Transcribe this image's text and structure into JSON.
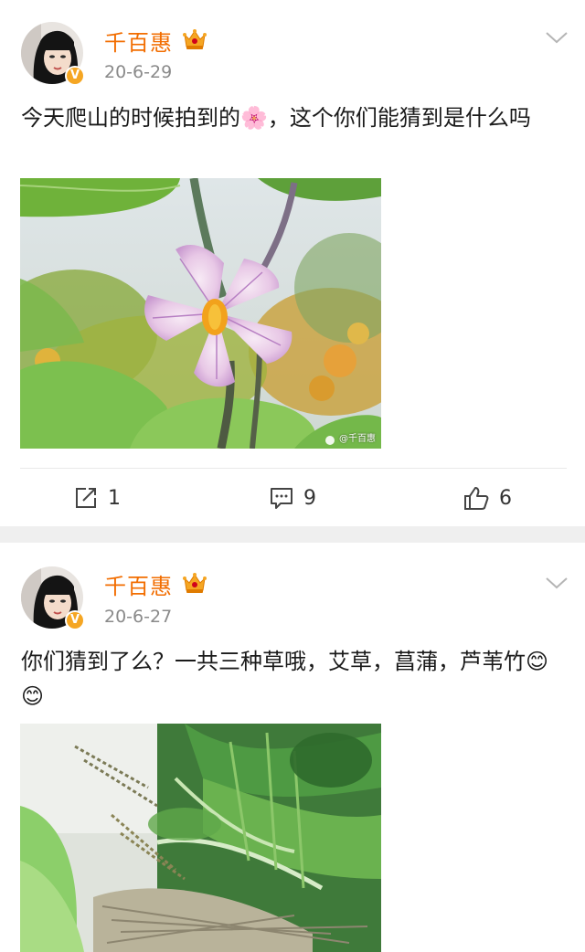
{
  "colors": {
    "username": "#f26d00",
    "verified_badge": "#f5a623",
    "separator": "#efefef"
  },
  "posts": [
    {
      "username": "千百惠",
      "time": "20-6-29",
      "verified_badge_icon": "verified-v-icon",
      "vip_icon": "crown-vip-icon",
      "text": "今天爬山的时候拍到的🌸，这个你们能猜到是什么吗",
      "image_watermark": "@千百惠",
      "actions": {
        "repost_count": "1",
        "comment_count": "9",
        "like_count": "6"
      }
    },
    {
      "username": "千百惠",
      "time": "20-6-27",
      "verified_badge_icon": "verified-v-icon",
      "vip_icon": "crown-vip-icon",
      "text": "你们猜到了么？一共三种草哦，艾草，菖蒲，芦苇竹😊😊"
    }
  ]
}
